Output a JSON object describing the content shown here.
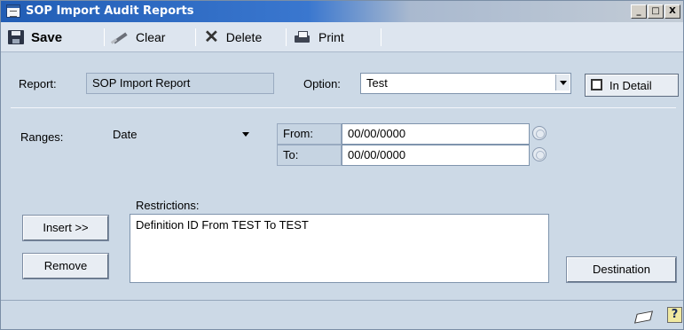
{
  "window": {
    "title": "SOP Import Audit Reports"
  },
  "title_buttons": {
    "minimize": "_",
    "maximize": "□",
    "close": "X"
  },
  "toolbar": {
    "save_label": "Save",
    "clear_label": "Clear",
    "delete_label": "Delete",
    "print_label": "Print"
  },
  "report": {
    "label": "Report:",
    "value": "SOP Import Report"
  },
  "option": {
    "label": "Option:",
    "value": "Test"
  },
  "in_detail": {
    "label": "In Detail",
    "checked": false
  },
  "ranges": {
    "label": "Ranges:",
    "value": "Date",
    "from_label": "From:",
    "from_value": "00/00/0000",
    "to_label": "To:",
    "to_value": "00/00/0000"
  },
  "restrictions": {
    "label": "Restrictions:",
    "items": [
      "Definition ID From TEST To TEST"
    ]
  },
  "buttons": {
    "insert": "Insert >>",
    "remove": "Remove",
    "destination": "Destination"
  },
  "colors": {
    "title_bar": "#215db5",
    "window_bg": "#ccd9e6",
    "toolbar_bg": "#dde5ef"
  }
}
